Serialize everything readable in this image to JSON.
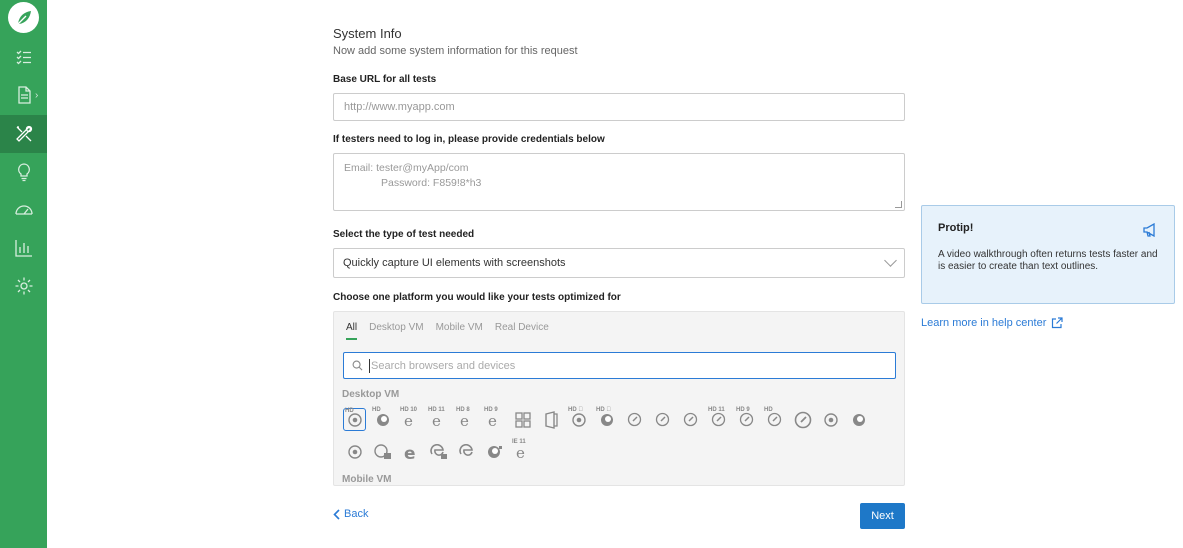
{
  "sidebar": {
    "items": [
      {
        "name": "tasks-icon"
      },
      {
        "name": "document-icon"
      },
      {
        "name": "tools-icon"
      },
      {
        "name": "lightbulb-icon"
      },
      {
        "name": "dashboard-icon"
      },
      {
        "name": "chart-icon"
      },
      {
        "name": "settings-icon"
      }
    ],
    "active_color": "#2b8449",
    "bg_color": "#36a35a"
  },
  "form": {
    "title": "System Info",
    "subtitle": "Now add some system information for this request",
    "base_url_label": "Base URL for all tests",
    "base_url_placeholder": "http://www.myapp.com",
    "credentials_label": "If testers need to log in, please provide credentials below",
    "credentials_line1": "Email: tester@myApp/com",
    "credentials_line2": "Password: F859!8*h3",
    "test_type_label": "Select the type of test needed",
    "test_type_value": "Quickly capture UI elements with screenshots",
    "platform_label": "Choose one platform you would like your tests optimized for",
    "platform_tabs": [
      "All",
      "Desktop VM",
      "Mobile VM",
      "Real Device"
    ],
    "search_placeholder": "Search browsers and devices",
    "section_desktop": "Desktop VM",
    "section_mobile": "Mobile VM",
    "back_label": "Back",
    "next_label": "Next"
  },
  "protip": {
    "title": "Protip!",
    "body": "A video walkthrough often returns tests faster and is easier to create than text outlines.",
    "learn_more": "Learn more in help center"
  },
  "accent": "#2b7bd6"
}
